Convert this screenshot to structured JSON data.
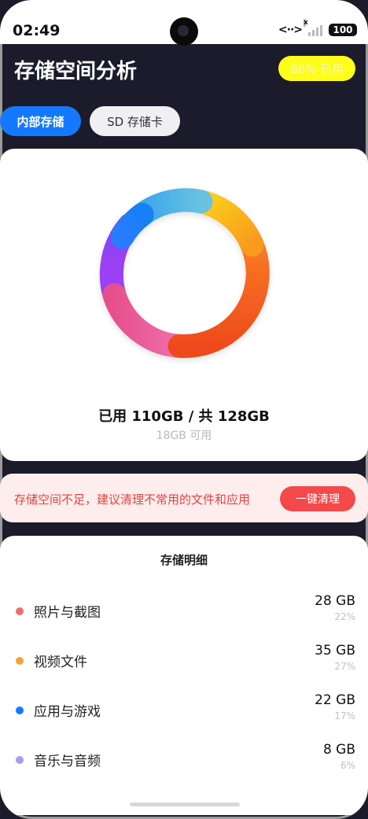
{
  "status_bar": {
    "time": "02:49",
    "code_symbol": "<··>",
    "signal_x": "x",
    "battery": "100"
  },
  "header": {
    "title": "存储空间分析",
    "usage_badge": "86% 已用"
  },
  "tabs": [
    {
      "label": "内部存储",
      "active": true
    },
    {
      "label": "SD 存储卡",
      "active": false
    }
  ],
  "storage_summary": {
    "used_text": "已用 110GB / 共 128GB",
    "free_text": "18GB 可用",
    "ring_colors": [
      "#fbbf0f",
      "#f45a2a",
      "#ec5b9a",
      "#9b40f4",
      "#1b7bff",
      "#5cb8e4"
    ]
  },
  "warning": {
    "text": "存储空间不足，建议清理不常用的文件和应用",
    "button_label": "一键清理"
  },
  "details": {
    "title": "存储明细",
    "items": [
      {
        "label": "照片与截图",
        "size": "28 GB",
        "percent": "22%",
        "color": "#f26b6b"
      },
      {
        "label": "视频文件",
        "size": "35 GB",
        "percent": "27%",
        "color": "#f8a23a"
      },
      {
        "label": "应用与游戏",
        "size": "22 GB",
        "percent": "17%",
        "color": "#1479ff"
      },
      {
        "label": "音乐与音频",
        "size": "8 GB",
        "percent": "6%",
        "color": "#a89cf0"
      }
    ]
  }
}
